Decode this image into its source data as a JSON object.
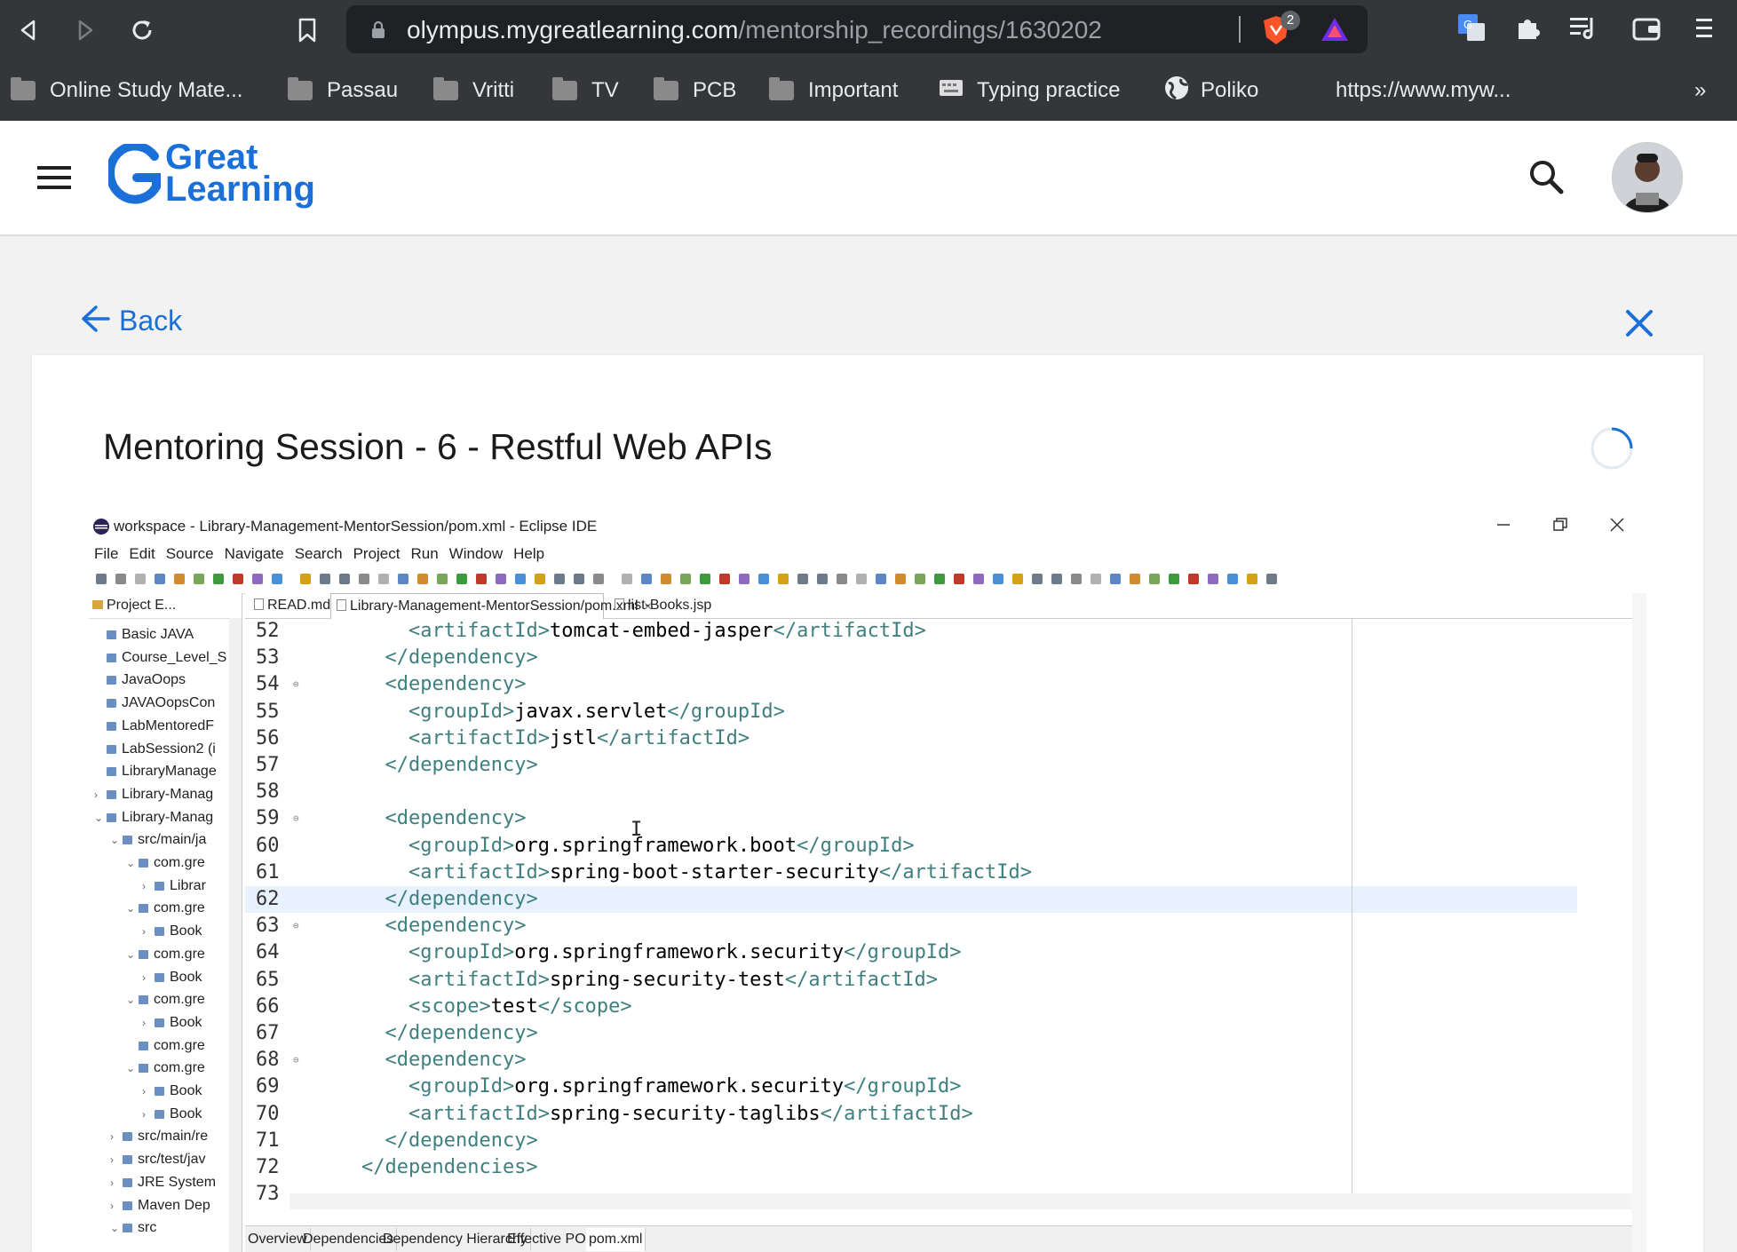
{
  "browser": {
    "url_domain": "olympus.mygreatlearning.com",
    "url_path": "/mentorship_recordings/1630202",
    "brave_badge": "2",
    "bookmarks": [
      "Online Study Mate...",
      "Passau",
      "Vritti",
      "TV",
      "PCB",
      "Important",
      "Typing practice",
      "Poliko",
      "https://www.myw..."
    ],
    "bookmarks_more": "»"
  },
  "site": {
    "logo_line1": "Great",
    "logo_line2": "Learning",
    "back_label": "Back",
    "session_title": "Mentoring Session - 6 - Restful Web APIs"
  },
  "eclipse": {
    "window_title": "workspace - Library-Management-MentorSession/pom.xml - Eclipse IDE",
    "menu": [
      "File",
      "Edit",
      "Source",
      "Navigate",
      "Search",
      "Project",
      "Run",
      "Window",
      "Help"
    ],
    "project_tab": "Project E...",
    "tree": [
      {
        "indent": 0,
        "arrow": "",
        "label": "Basic JAVA"
      },
      {
        "indent": 0,
        "arrow": "",
        "label": "Course_Level_S"
      },
      {
        "indent": 0,
        "arrow": "",
        "label": "JavaOops"
      },
      {
        "indent": 0,
        "arrow": "",
        "label": "JAVAOopsCon"
      },
      {
        "indent": 0,
        "arrow": "",
        "label": "LabMentoredF"
      },
      {
        "indent": 0,
        "arrow": "",
        "label": "LabSession2 (i"
      },
      {
        "indent": 0,
        "arrow": "",
        "label": "LibraryManage"
      },
      {
        "indent": 0,
        "arrow": ">",
        "label": "Library-Manag"
      },
      {
        "indent": 0,
        "arrow": "v",
        "label": "Library-Manag"
      },
      {
        "indent": 1,
        "arrow": "v",
        "label": "src/main/ja"
      },
      {
        "indent": 2,
        "arrow": "v",
        "label": "com.gre"
      },
      {
        "indent": 3,
        "arrow": ">",
        "label": "Librar"
      },
      {
        "indent": 2,
        "arrow": "v",
        "label": "com.gre"
      },
      {
        "indent": 3,
        "arrow": ">",
        "label": "Book"
      },
      {
        "indent": 2,
        "arrow": "v",
        "label": "com.gre"
      },
      {
        "indent": 3,
        "arrow": ">",
        "label": "Book"
      },
      {
        "indent": 2,
        "arrow": "v",
        "label": "com.gre"
      },
      {
        "indent": 3,
        "arrow": ">",
        "label": "Book"
      },
      {
        "indent": 2,
        "arrow": "",
        "label": "com.gre"
      },
      {
        "indent": 2,
        "arrow": "v",
        "label": "com.gre"
      },
      {
        "indent": 3,
        "arrow": ">",
        "label": "Book"
      },
      {
        "indent": 3,
        "arrow": ">",
        "label": "Book"
      },
      {
        "indent": 1,
        "arrow": ">",
        "label": "src/main/re"
      },
      {
        "indent": 1,
        "arrow": ">",
        "label": "src/test/jav"
      },
      {
        "indent": 1,
        "arrow": ">",
        "label": "JRE System"
      },
      {
        "indent": 1,
        "arrow": ">",
        "label": "Maven Dep"
      },
      {
        "indent": 1,
        "arrow": "v",
        "label": "src"
      }
    ],
    "editor_tabs": [
      {
        "label": "READ.md",
        "active": false
      },
      {
        "label": "Library-Management-MentorSession/pom.xml",
        "active": true
      },
      {
        "label": "list-Books.jsp",
        "active": false
      }
    ],
    "code_lines": [
      {
        "n": "52",
        "fold": "",
        "indent": 8,
        "open": "<artifactId>",
        "text": "tomcat-embed-jasper",
        "close": "</artifactId>"
      },
      {
        "n": "53",
        "fold": "",
        "indent": 6,
        "open": "</dependency>",
        "text": "",
        "close": ""
      },
      {
        "n": "54",
        "fold": "⊖",
        "indent": 6,
        "open": "<dependency>",
        "text": "",
        "close": ""
      },
      {
        "n": "55",
        "fold": "",
        "indent": 8,
        "open": "<groupId>",
        "text": "javax.servlet",
        "close": "</groupId>"
      },
      {
        "n": "56",
        "fold": "",
        "indent": 8,
        "open": "<artifactId>",
        "text": "jstl",
        "close": "</artifactId>"
      },
      {
        "n": "57",
        "fold": "",
        "indent": 6,
        "open": "</dependency>",
        "text": "",
        "close": ""
      },
      {
        "n": "58",
        "fold": "",
        "indent": 0,
        "open": "",
        "text": "",
        "close": ""
      },
      {
        "n": "59",
        "fold": "⊖",
        "indent": 6,
        "open": "<dependency>",
        "text": "",
        "close": ""
      },
      {
        "n": "60",
        "fold": "",
        "indent": 8,
        "open": "<groupId>",
        "text": "org.springframework.boot",
        "close": "</groupId>"
      },
      {
        "n": "61",
        "fold": "",
        "indent": 8,
        "open": "<artifactId>",
        "text": "spring-boot-starter-security",
        "close": "</artifactId>"
      },
      {
        "n": "62",
        "fold": "",
        "indent": 6,
        "open": "</dependency>",
        "text": "",
        "close": "",
        "current": true
      },
      {
        "n": "63",
        "fold": "⊖",
        "indent": 6,
        "open": "<dependency>",
        "text": "",
        "close": ""
      },
      {
        "n": "64",
        "fold": "",
        "indent": 8,
        "open": "<groupId>",
        "text": "org.springframework.security",
        "close": "</groupId>"
      },
      {
        "n": "65",
        "fold": "",
        "indent": 8,
        "open": "<artifactId>",
        "text": "spring-security-test",
        "close": "</artifactId>"
      },
      {
        "n": "66",
        "fold": "",
        "indent": 8,
        "open": "<scope>",
        "text": "test",
        "close": "</scope>"
      },
      {
        "n": "67",
        "fold": "",
        "indent": 6,
        "open": "</dependency>",
        "text": "",
        "close": ""
      },
      {
        "n": "68",
        "fold": "⊖",
        "indent": 6,
        "open": "<dependency>",
        "text": "",
        "close": ""
      },
      {
        "n": "69",
        "fold": "",
        "indent": 8,
        "open": "<groupId>",
        "text": "org.springframework.security",
        "close": "</groupId>"
      },
      {
        "n": "70",
        "fold": "",
        "indent": 8,
        "open": "<artifactId>",
        "text": "spring-security-taglibs",
        "close": "</artifactId>"
      },
      {
        "n": "71",
        "fold": "",
        "indent": 6,
        "open": "</dependency>",
        "text": "",
        "close": ""
      },
      {
        "n": "72",
        "fold": "",
        "indent": 4,
        "open": "</dependencies>",
        "text": "",
        "close": ""
      },
      {
        "n": "73",
        "fold": "",
        "indent": 0,
        "open": "",
        "text": "",
        "close": ""
      }
    ],
    "pom_tabs": [
      "Overview",
      "Dependencies",
      "Dependency Hierarchy",
      "Effective POM",
      "pom.xml"
    ],
    "pom_active": "pom.xml"
  },
  "colors": {
    "brand_blue": "#1a6fd8",
    "xml_tag": "#3f7f7f",
    "current_line": "#e8f2fe",
    "browser_bar": "#35363a"
  }
}
